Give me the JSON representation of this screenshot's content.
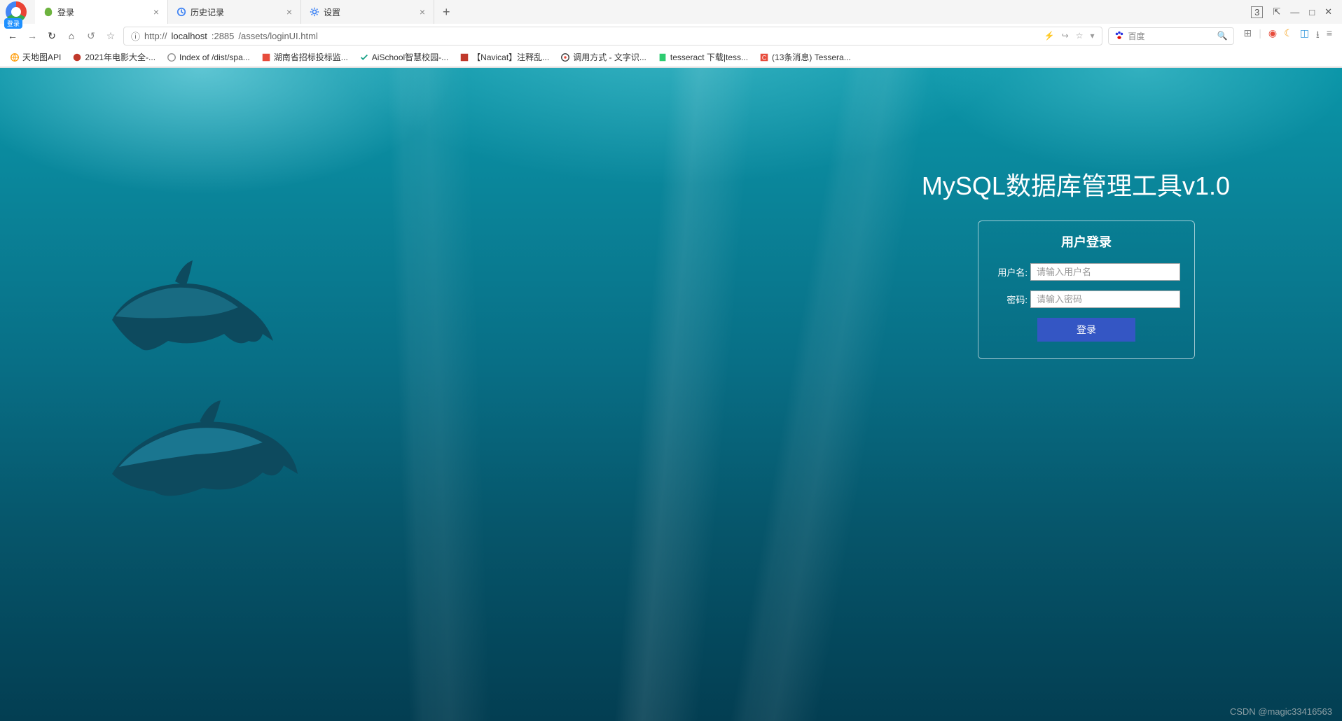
{
  "tabs": [
    {
      "title": "登录",
      "active": true
    },
    {
      "title": "历史记录",
      "active": false
    },
    {
      "title": "设置",
      "active": false
    }
  ],
  "login_badge": "登录",
  "win": {
    "count": "3"
  },
  "url": {
    "protocol": "http://",
    "host": "localhost",
    "port": ":2885",
    "path": "/assets/loginUI.html"
  },
  "search": {
    "placeholder": "百度"
  },
  "bookmarks": [
    "天地图API",
    "2021年电影大全-...",
    "Index of /dist/spa...",
    "湖南省招标投标监...",
    "AiSchool智慧校园-...",
    "【Navicat】注释乱...",
    "调用方式 - 文字识...",
    "tesseract 下载|tess...",
    "(13条消息) Tessera..."
  ],
  "page": {
    "title": "MySQL数据库管理工具v1.0",
    "login_heading": "用户登录",
    "username_label": "用户名:",
    "username_placeholder": "请输入用户名",
    "password_label": "密码:",
    "password_placeholder": "请输入密码",
    "login_button": "登录"
  },
  "watermark": "CSDN @magic33416563"
}
